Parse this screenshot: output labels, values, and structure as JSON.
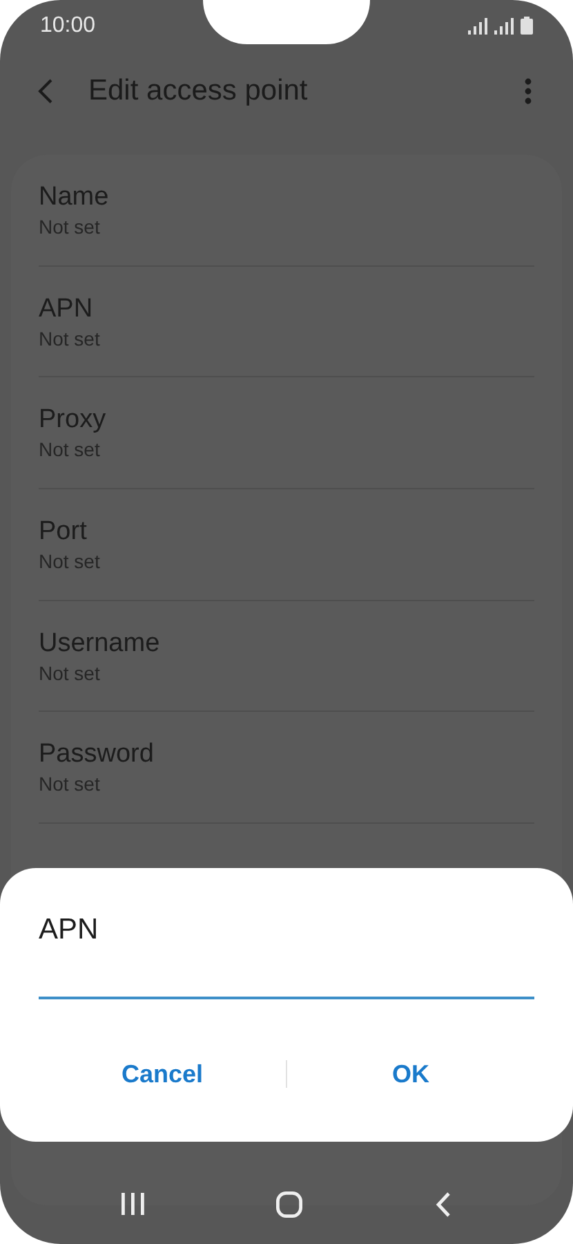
{
  "status_bar": {
    "time": "10:00"
  },
  "header": {
    "title": "Edit access point"
  },
  "fields": [
    {
      "label": "Name",
      "value": "Not set"
    },
    {
      "label": "APN",
      "value": "Not set"
    },
    {
      "label": "Proxy",
      "value": "Not set"
    },
    {
      "label": "Port",
      "value": "Not set"
    },
    {
      "label": "Username",
      "value": "Not set"
    },
    {
      "label": "Password",
      "value": "Not set"
    }
  ],
  "dialog": {
    "title": "APN",
    "buttons": [
      "Cancel",
      "OK"
    ]
  }
}
